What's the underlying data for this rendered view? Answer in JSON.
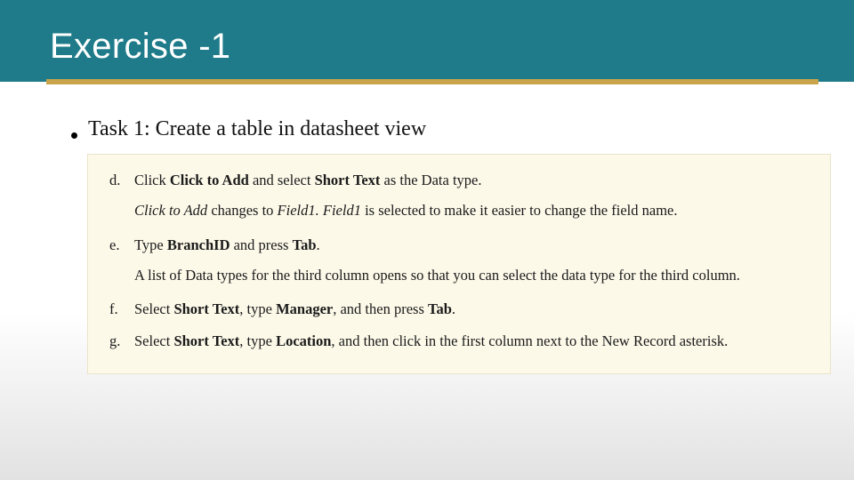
{
  "colors": {
    "header_bg": "#1f7b8a",
    "accent": "#c9a44b",
    "panel_bg": "#fcf9e9"
  },
  "slide": {
    "title": "Exercise -1",
    "bullet": "Task 1: Create a table in datasheet view"
  },
  "steps": {
    "d": {
      "letter": "d.",
      "pre1": "Click ",
      "b1": "Click to Add",
      "mid1": " and select ",
      "b2": "Short Text",
      "post1": " as the Data type.",
      "sub_i1": "Click to Add",
      "sub_mid1": " changes to ",
      "sub_i2": "Field1. Field1",
      "sub_post1": " is selected to make it easier to change the field name."
    },
    "e": {
      "letter": "e.",
      "pre1": "Type ",
      "b1": "BranchID",
      "mid1": " and press ",
      "b2": "Tab",
      "post1": ".",
      "sub": "A list of Data types for the third column opens so that you can select the data type for the third column."
    },
    "f": {
      "letter": "f.",
      "pre1": "Select ",
      "b1": "Short Text",
      "mid1": ", type ",
      "b2": "Manager",
      "mid2": ", and then press ",
      "b3": "Tab",
      "post1": "."
    },
    "g": {
      "letter": "g.",
      "pre1": "Select ",
      "b1": "Short Text",
      "mid1": ", type ",
      "b2": "Location",
      "post1": ", and then click in the first column next to the New Record asterisk."
    }
  }
}
